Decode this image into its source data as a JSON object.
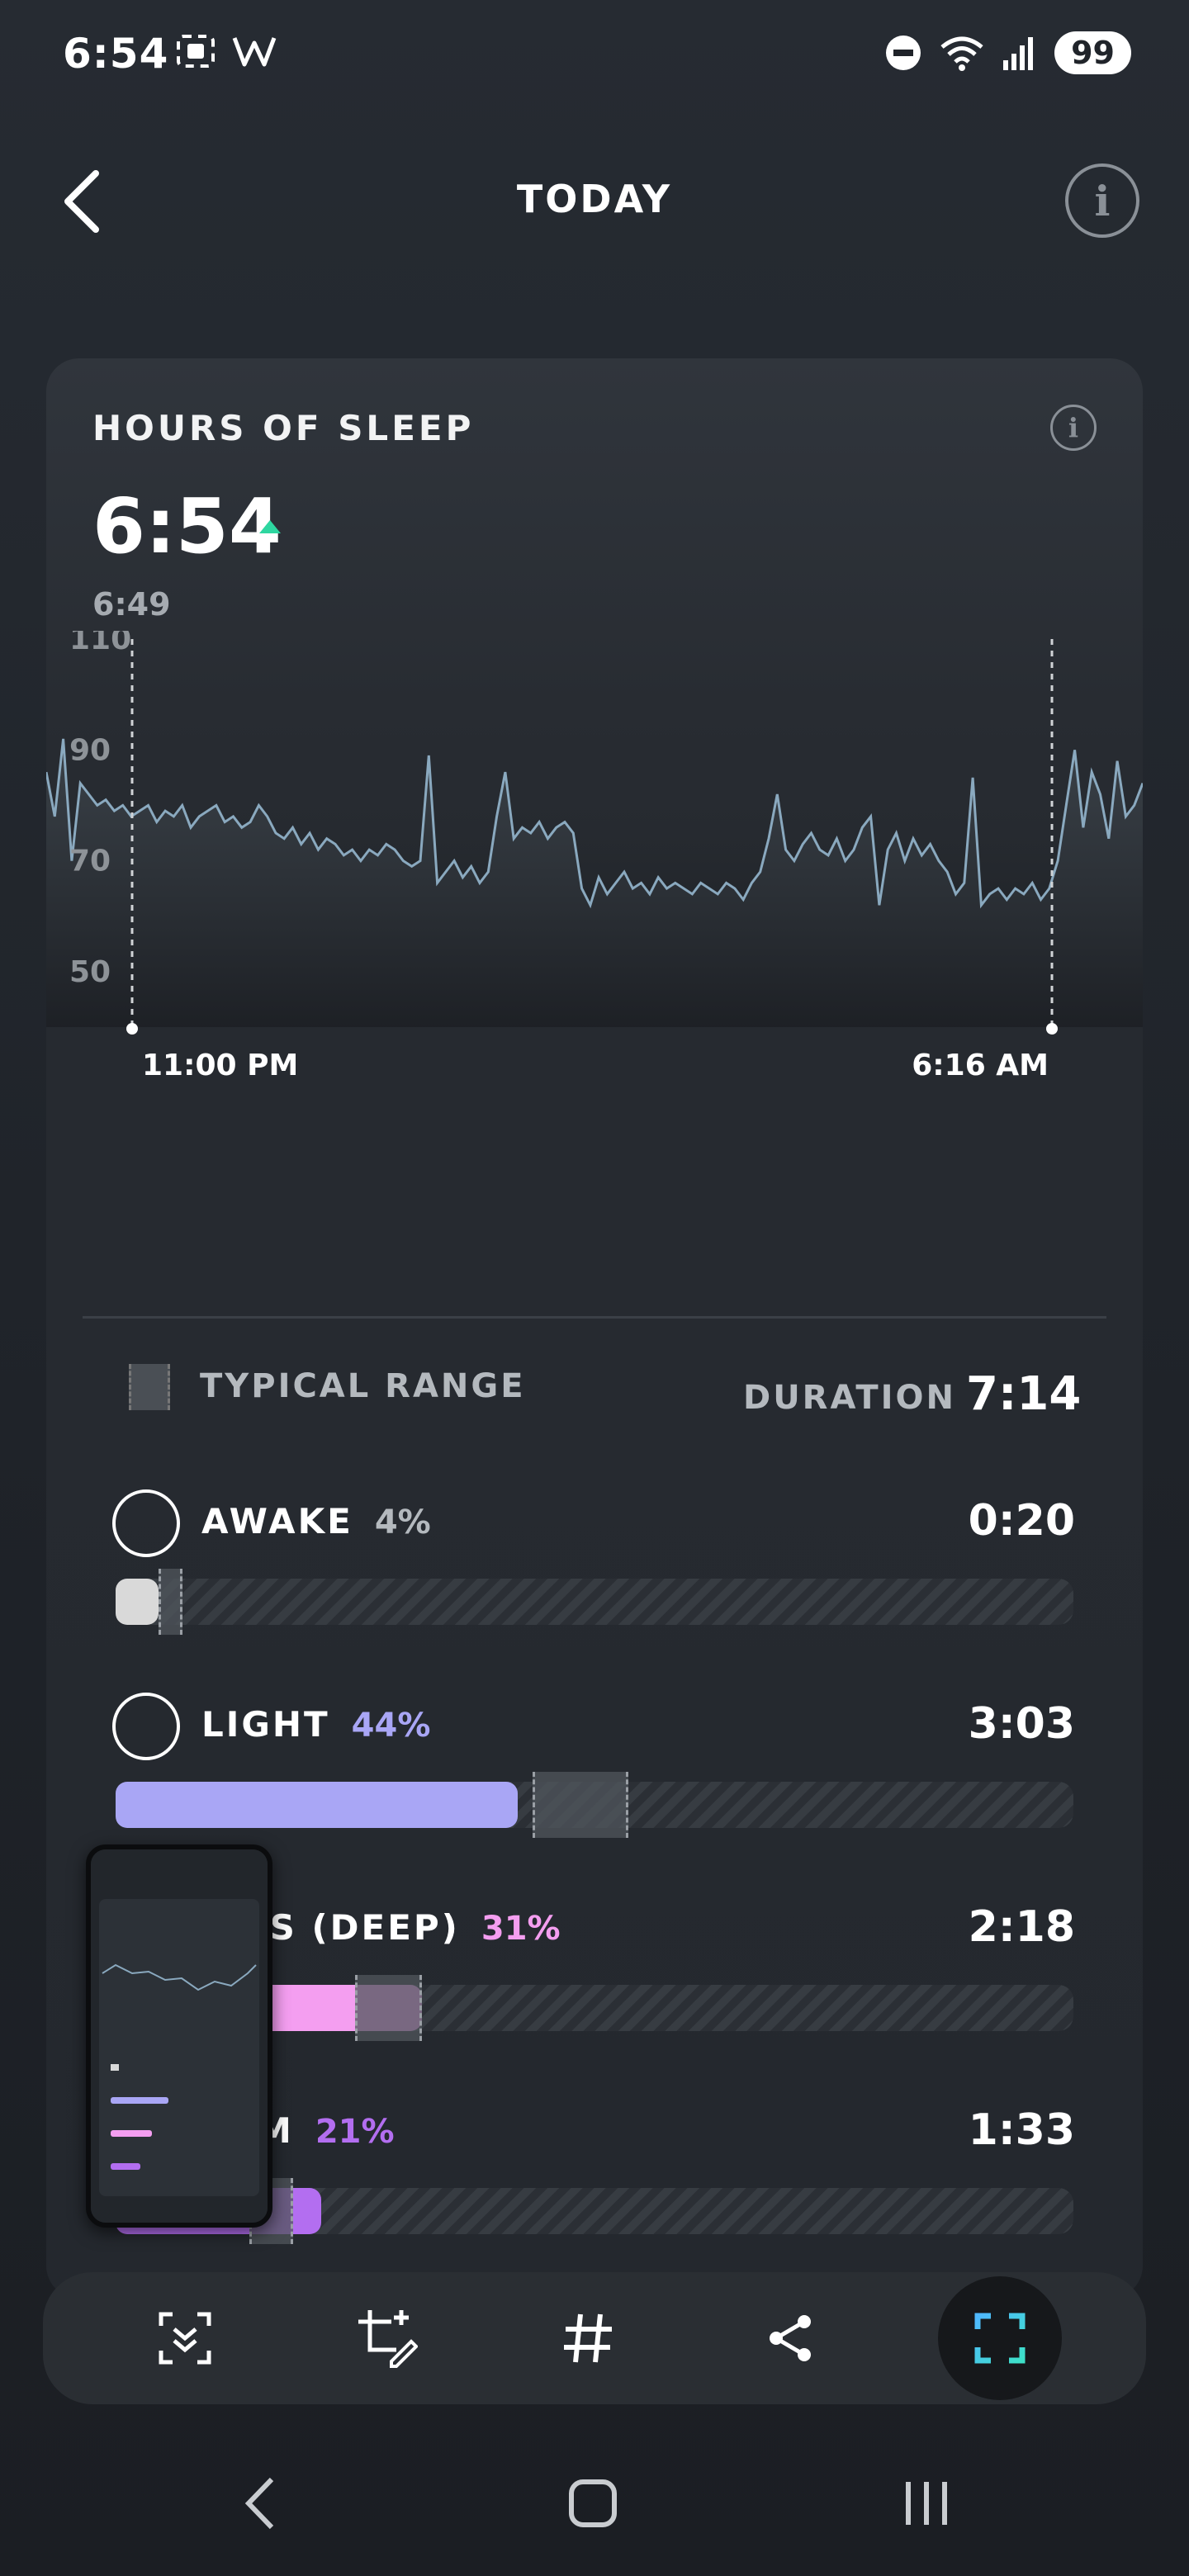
{
  "status_bar": {
    "time": "6:54",
    "battery": "99",
    "left_icons": [
      "screenshot-icon",
      "w-logo-icon"
    ],
    "right_icons": [
      "do-not-disturb-icon",
      "wifi-icon",
      "signal-icon"
    ]
  },
  "header": {
    "title": "TODAY"
  },
  "card": {
    "title": "HOURS OF SLEEP",
    "value": "6:54",
    "previous_value": "6:49",
    "trend": "up"
  },
  "chart_data": {
    "type": "line",
    "ylim": [
      40,
      110
    ],
    "yticks": [
      "110",
      "90",
      "70",
      "50"
    ],
    "x_start_label": "11:00 PM",
    "x_end_label": "6:16 AM",
    "series": [
      {
        "values": [
          86,
          78,
          92,
          70,
          84,
          82,
          80,
          81,
          79,
          80,
          78,
          79,
          80,
          77,
          79,
          78,
          80,
          76,
          78,
          79,
          80,
          77,
          78,
          76,
          77,
          80,
          78,
          75,
          74,
          76,
          73,
          75,
          72,
          74,
          73,
          71,
          72,
          70,
          72,
          71,
          73,
          72,
          70,
          69,
          70,
          89,
          66,
          68,
          70,
          67,
          69,
          66,
          68,
          78,
          86,
          74,
          76,
          75,
          77,
          74,
          76,
          77,
          75,
          65,
          62,
          67,
          64,
          66,
          68,
          65,
          66,
          64,
          67,
          65,
          66,
          65,
          64,
          66,
          65,
          64,
          66,
          65,
          63,
          66,
          68,
          74,
          82,
          72,
          70,
          73,
          75,
          72,
          71,
          74,
          70,
          72,
          76,
          78,
          62,
          72,
          75,
          70,
          74,
          71,
          73,
          70,
          68,
          64,
          66,
          85,
          62,
          64,
          65,
          63,
          65,
          64,
          66,
          63,
          65,
          70,
          80,
          90,
          76,
          86,
          82,
          74,
          88,
          78,
          80,
          84
        ],
        "color": "#8aa9bf"
      }
    ]
  },
  "summary": {
    "typical_range_label": "TYPICAL RANGE",
    "duration_label": "DURATION",
    "duration_value": "7:14"
  },
  "stages": [
    {
      "name": "AWAKE",
      "pct": "4%",
      "time": "0:20",
      "fraction": 0.04,
      "typical_fraction": [
        0.045,
        0.07
      ],
      "color": "#d9d9d9",
      "pct_color": "#b4b9be"
    },
    {
      "name": "LIGHT",
      "pct": "44%",
      "time": "3:03",
      "fraction": 0.42,
      "typical_fraction": [
        0.435,
        0.535
      ],
      "color": "#a9a6f5",
      "pct_color": "#a9a6f5"
    },
    {
      "name": "SWS (DEEP)",
      "pct": "31%",
      "time": "2:18",
      "fraction": 0.32,
      "typical_fraction": [
        0.25,
        0.32
      ],
      "color": "#f49ef0",
      "pct_color": "#f49ef0"
    },
    {
      "name": "REM",
      "pct": "21%",
      "time": "1:33",
      "fraction": 0.215,
      "typical_fraction": [
        0.14,
        0.185
      ],
      "color": "#b36ef0",
      "pct_color": "#b36ef0"
    }
  ],
  "toolbar": {
    "items": [
      "scroll-capture-icon",
      "edit-crop-icon",
      "hashtag-icon",
      "share-icon",
      "screenshot-frame-icon"
    ]
  },
  "nav": {
    "items": [
      "back-nav-icon",
      "home-nav-icon",
      "recents-nav-icon"
    ]
  }
}
